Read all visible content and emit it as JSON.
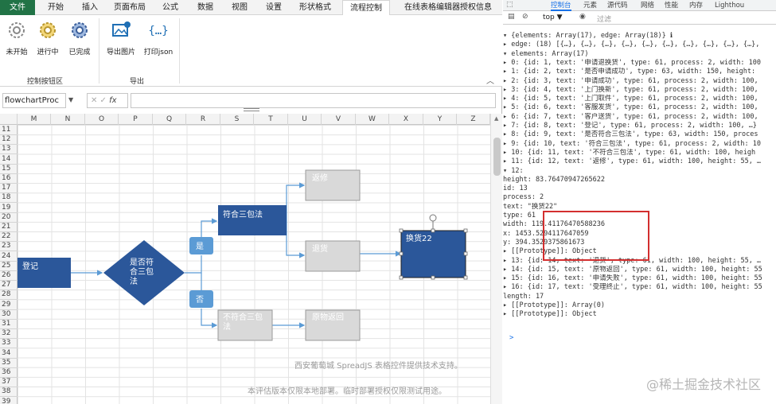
{
  "ribbon_tabs": [
    "文件",
    "开始",
    "插入",
    "页面布局",
    "公式",
    "数据",
    "视图",
    "设置",
    "形状格式",
    "流程控制",
    "在线表格编辑器授权信息"
  ],
  "control_group": {
    "label": "控制按钮区",
    "buttons": [
      "未开始",
      "进行中",
      "已完成"
    ]
  },
  "export_group": {
    "label": "导出",
    "buttons": [
      "导出图片",
      "打印json"
    ]
  },
  "collapse_icon": "chevron-up-icon",
  "formula_bar": {
    "name_box": "flowchartProc",
    "fx": "fx",
    "value": ""
  },
  "columns": [
    "M",
    "N",
    "O",
    "P",
    "Q",
    "R",
    "S",
    "T",
    "U",
    "V",
    "W",
    "X",
    "Y",
    "Z"
  ],
  "rows": [
    "11",
    "12",
    "13",
    "14",
    "15",
    "16",
    "17",
    "18",
    "19",
    "20",
    "21",
    "22",
    "23",
    "24",
    "25",
    "26",
    "27",
    "28",
    "29",
    "30",
    "31",
    "32",
    "33",
    "34",
    "35",
    "36",
    "37",
    "38",
    "39"
  ],
  "flow": {
    "register": "登记",
    "decision_main": "是否符合三包法",
    "yes": "是",
    "no": "否",
    "meets": "符合三包法",
    "repair": "返修",
    "return": "退货",
    "exchange": "换货22",
    "not_meets": "不符合三包法",
    "back": "原物返回"
  },
  "colors": {
    "primary": "#2b579a",
    "excel_green": "#217346",
    "pale_fill": "#d9d9d9",
    "yes_no_fill": "#5b9bd5",
    "highlight": "#d32f2f"
  },
  "watermark": {
    "line1": "西安葡萄城 SpreadJS 表格控件提供技术支持。",
    "line2": "本评估版本仅限本地部署。临时部署授权仅限测试用途。"
  },
  "devtools": {
    "tabs": [
      "控制台",
      "元素",
      "源代码",
      "网络",
      "性能",
      "内存",
      "Lighthou"
    ],
    "context": "top ▼",
    "filter_placeholder": "过滤",
    "lines": [
      "▾ {elements: Array(17), edge: Array(18)} ℹ",
      "  ▸ edge: (18) [{…}, {…}, {…}, {…}, {…}, {…}, {…}, {…}, {…}, {…},",
      "  ▾ elements: Array(17)",
      "    ▸ 0: {id: 1, text: '申请退换货', type: 61, process: 2, width: 100",
      "    ▸ 1: {id: 2, text: '是否申请成功', type: 63, width: 150, height:",
      "    ▸ 2: {id: 3, text: '申请成功', type: 61, process: 2, width: 100,",
      "    ▸ 3: {id: 4, text: '上门换新', type: 61, process: 2, width: 100,",
      "    ▸ 4: {id: 5, text: '上门取件', type: 61, process: 2, width: 100,",
      "    ▸ 5: {id: 6, text: '客服发货', type: 61, process: 2, width: 100,",
      "    ▸ 6: {id: 7, text: '客户送货', type: 61, process: 2, width: 100,",
      "    ▸ 7: {id: 8, text: '登记', type: 61, process: 2, width: 100, …}",
      "    ▸ 8: {id: 9, text: '是否符合三包法', type: 63, width: 150, proces",
      "    ▸ 9: {id: 10, text: '符合三包法', type: 61, process: 2, width: 10",
      "    ▸ 10: {id: 11, text: '不符合三包法', type: 61, width: 100, heigh",
      "    ▸ 11: {id: 12, text: '返修', type: 61, width: 100, height: 55, …",
      "    ▾ 12:",
      "        height: 83.76470947265622",
      "        id: 13",
      "        process: 2",
      "        text: \"换货22\"",
      "        type: 61",
      "        width: 119.41176470588236",
      "        x: 1453.5294117647059",
      "        y: 394.3529375861673",
      "      ▸ [[Prototype]]: Object",
      "    ▸ 13: {id: 14, text: '退货', type: 61, width: 100, height: 55, …",
      "    ▸ 14: {id: 15, text: '原物返回', type: 61, width: 100, height: 55",
      "    ▸ 15: {id: 16, text: '申请失败', type: 61, width: 100, height: 55",
      "    ▸ 16: {id: 17, text: '受理终止', type: 61, width: 100, height: 55",
      "      length: 17",
      "    ▸ [[Prototype]]: Array(0)",
      "  ▸ [[Prototype]]: Object"
    ],
    "prompt": ">",
    "watermark": "@稀土掘金技术社区"
  }
}
